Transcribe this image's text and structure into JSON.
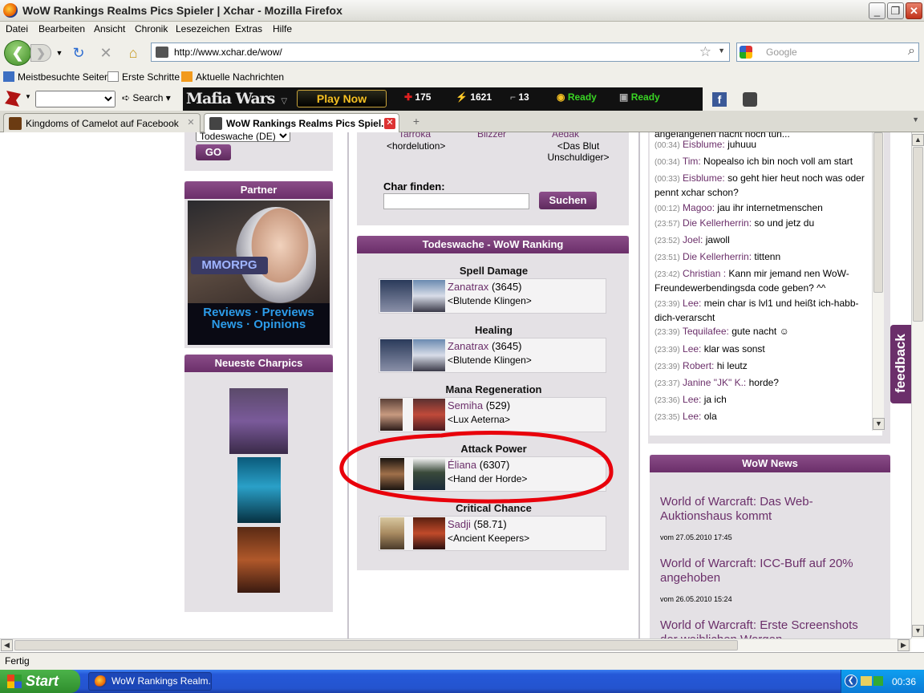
{
  "window": {
    "title": "WoW Rankings Realms Pics Spieler | Xchar - Mozilla Firefox"
  },
  "menu": [
    "Datei",
    "Bearbeiten",
    "Ansicht",
    "Chronik",
    "Lesezeichen",
    "Extras",
    "Hilfe"
  ],
  "nav": {
    "url": "http://www.xchar.de/wow/",
    "search_placeholder": "Google"
  },
  "bookmarks": [
    "Meistbesuchte Seiten",
    "Erste Schritte",
    "Aktuelle Nachrichten"
  ],
  "mafia": {
    "search_label": "Search",
    "logo": "Mafia Wars",
    "play_now": "Play Now",
    "health": "175",
    "energy": "1621",
    "ammo": "13",
    "ready1": "Ready",
    "ready2": "Ready",
    "fb": "f"
  },
  "tabs": [
    {
      "label": "Kingdoms of Camelot auf Facebook"
    },
    {
      "label": "WoW Rankings Realms Pics Spiel..."
    }
  ],
  "left": {
    "realm_select": "Todeswache (DE)",
    "go": "GO",
    "partner_title": "Partner",
    "ad_brand": "MMORPG",
    "ad_line1": "Reviews · Previews",
    "ad_line2": "News · Opinions",
    "charpics_title": "Neueste Charpics"
  },
  "center": {
    "top_names": [
      "Tarroka",
      "Blizzer",
      "Aedak"
    ],
    "top_guild1": "<hordelution>",
    "top_guild3a": "<Das Blut",
    "top_guild3b": "Unschuldiger>",
    "char_find_label": "Char finden:",
    "search_button": "Suchen",
    "ranking_title": "Todeswache - WoW Ranking",
    "categories": [
      {
        "title": "Spell Damage",
        "name": "Zanatrax",
        "value": "(3645)",
        "guild": "<Blutende Klingen>"
      },
      {
        "title": "Healing",
        "name": "Zanatrax",
        "value": "(3645)",
        "guild": "<Blutende Klingen>"
      },
      {
        "title": "Mana Regeneration",
        "name": "Semiha",
        "value": "(529)",
        "guild": "<Lux Aeterna>"
      },
      {
        "title": "Attack Power",
        "name": "Éliana",
        "value": "(6307)",
        "guild": "<Hand der Horde>"
      },
      {
        "title": "Critical Chance",
        "name": "Sadji",
        "value": "(58.71)",
        "guild": "<Ancient Keepers>"
      }
    ]
  },
  "chat": [
    {
      "time": "",
      "name": "",
      "text": "angefangenen nacht noch tun..."
    },
    {
      "time": "(00:34)",
      "name": "Eisblume:",
      "text": "juhuuu"
    },
    {
      "time": "(00:34)",
      "name": "Tim:",
      "text": "Nopealso ich bin noch voll am start"
    },
    {
      "time": "(00:33)",
      "name": "Eisblume:",
      "text": "so geht hier heut noch was oder pennt xchar schon?"
    },
    {
      "time": "(00:12)",
      "name": "Magoo:",
      "text": "jau ihr internetmenschen"
    },
    {
      "time": "(23:57)",
      "name": "Die Kellerherrin:",
      "text": "so und jetz du"
    },
    {
      "time": "(23:52)",
      "name": "Joel:",
      "text": "jawoll"
    },
    {
      "time": "(23:51)",
      "name": "Die Kellerherrin:",
      "text": "tittenn"
    },
    {
      "time": "(23:42)",
      "name": "Christian :",
      "text": "Kann mir jemand nen WoW-Freundewerbendingsda code geben? ^^"
    },
    {
      "time": "(23:39)",
      "name": "Lee:",
      "text": "mein char is lvl1 und heißt ich-habb-dich-verarscht"
    },
    {
      "time": "(23:39)",
      "name": "Tequilafee:",
      "text": "gute nacht ☺"
    },
    {
      "time": "(23:39)",
      "name": "Lee:",
      "text": "klar was sonst"
    },
    {
      "time": "(23:39)",
      "name": "Robert:",
      "text": "hi leutz"
    },
    {
      "time": "(23:37)",
      "name": "Janine \"JK\" K.:",
      "text": "horde?"
    },
    {
      "time": "(23:36)",
      "name": "Lee:",
      "text": "ja ich"
    },
    {
      "time": "(23:35)",
      "name": "Lee:",
      "text": "ola"
    }
  ],
  "news": {
    "title": "WoW News",
    "items": [
      {
        "headline": "World of Warcraft: Das Web-Auktionshaus kommt",
        "date": "vom 27.05.2010 17:45"
      },
      {
        "headline": "World of Warcraft: ICC-Buff auf 20% angehoben",
        "date": "vom 26.05.2010 15:24"
      },
      {
        "headline": "World of Warcraft: Erste Screenshots der weiblichen Worgen",
        "date": ""
      }
    ]
  },
  "feedback": "feedback",
  "status": "Fertig",
  "taskbar": {
    "start": "Start",
    "item": "WoW Rankings Realm...",
    "clock": "00:36"
  },
  "colors": {
    "accent": "#6b2f6a",
    "panel": "#e4e1e5",
    "annotation": "#e8000b"
  }
}
